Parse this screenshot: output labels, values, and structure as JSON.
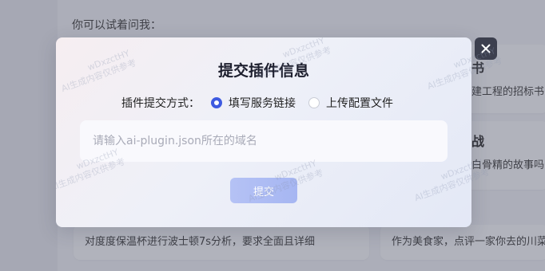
{
  "background": {
    "prompt_heading": "你可以试着问我：",
    "cards": [
      {
        "title": "书",
        "description": "建工程的招标书"
      },
      {
        "title": "战",
        "description": "白骨精的故事吗"
      }
    ],
    "bottom_items": [
      "对度度保温杯进行波士顿7s分析，要求全面且详细",
      "作为美食家，点评一家你去的川菜"
    ]
  },
  "modal": {
    "title": "提交插件信息",
    "method_label": "插件提交方式：",
    "options": [
      {
        "label": "填写服务链接",
        "selected": true
      },
      {
        "label": "上传配置文件",
        "selected": false
      }
    ],
    "input": {
      "placeholder": "请输入ai-plugin.json所在的域名",
      "value": ""
    },
    "submit_label": "提交"
  },
  "close_icon": "close-icon",
  "watermark": {
    "line1": "wDxzctHY",
    "line2": "AI生成内容仅供参考"
  },
  "colors": {
    "accent": "#3e5ae0",
    "submit_bg": "#b0bef4",
    "overlay": "#50546a"
  }
}
